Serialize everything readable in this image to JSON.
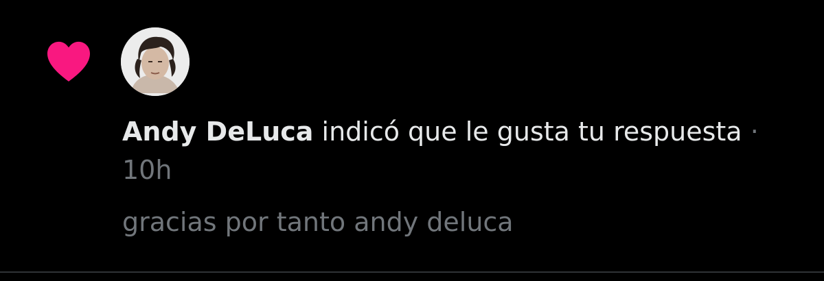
{
  "notification": {
    "type_icon": "heart-icon",
    "author": {
      "name": "Andy DeLuca",
      "avatar_icon": "avatar"
    },
    "action_text": "indicó que le gusta tu respuesta",
    "separator": "·",
    "time": "10h",
    "reply_preview": "gracias por tanto andy deluca"
  },
  "colors": {
    "background": "#000000",
    "heart": "#f91880",
    "primary_text": "#e7e9ea",
    "secondary_text": "#71767b",
    "divider": "#2f3336"
  }
}
